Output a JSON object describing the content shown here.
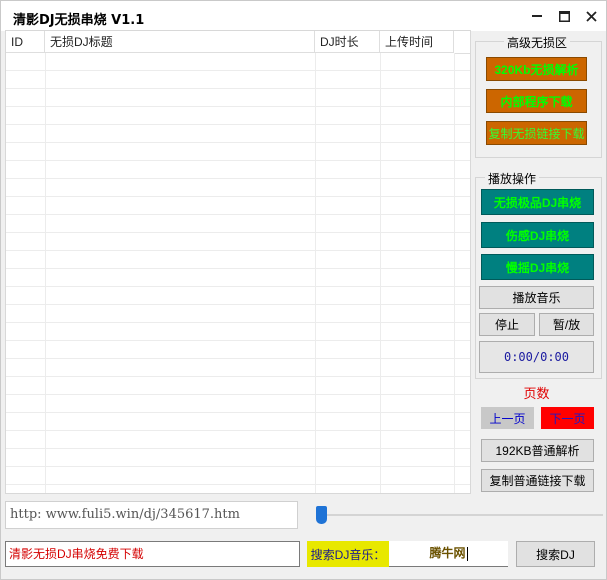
{
  "window": {
    "title": "清影DJ无损串烧 V1.1"
  },
  "table": {
    "columns": [
      "ID",
      "无损DJ标题",
      "DJ时长",
      "上传时间"
    ]
  },
  "lossless_group": {
    "title": "高级无损区",
    "buttons": [
      "320Kb无损解析",
      "内部程序下载",
      "复制无损链接下载"
    ]
  },
  "play_group": {
    "title": "播放操作",
    "buttons": [
      "无损极品DJ串烧",
      "伤感DJ串烧",
      "慢摇DJ串烧"
    ],
    "play_label": "播放音乐",
    "stop_label": "停止",
    "pause_label": "暂/放",
    "time_display": "0:00/0:00"
  },
  "pager": {
    "label": "页数",
    "prev": "上一页",
    "next": "下一页"
  },
  "actions": {
    "parse192": "192KB普通解析",
    "copy_normal": "复制普通链接下载"
  },
  "url_field": {
    "value": "http: www.fuli5.win/dj/345617.htm"
  },
  "slider": {
    "position": 0.0
  },
  "info_field": {
    "value": "清影无损DJ串烧免费下载"
  },
  "search": {
    "label": "搜索DJ音乐：",
    "value": "腾牛网",
    "button": "搜索DJ"
  },
  "colors": {
    "orange": "#cc6600",
    "teal": "#008080",
    "green_text": "#00ff00",
    "red": "#ff0000",
    "blue": "#0000cc",
    "yellow": "#e8e800"
  }
}
